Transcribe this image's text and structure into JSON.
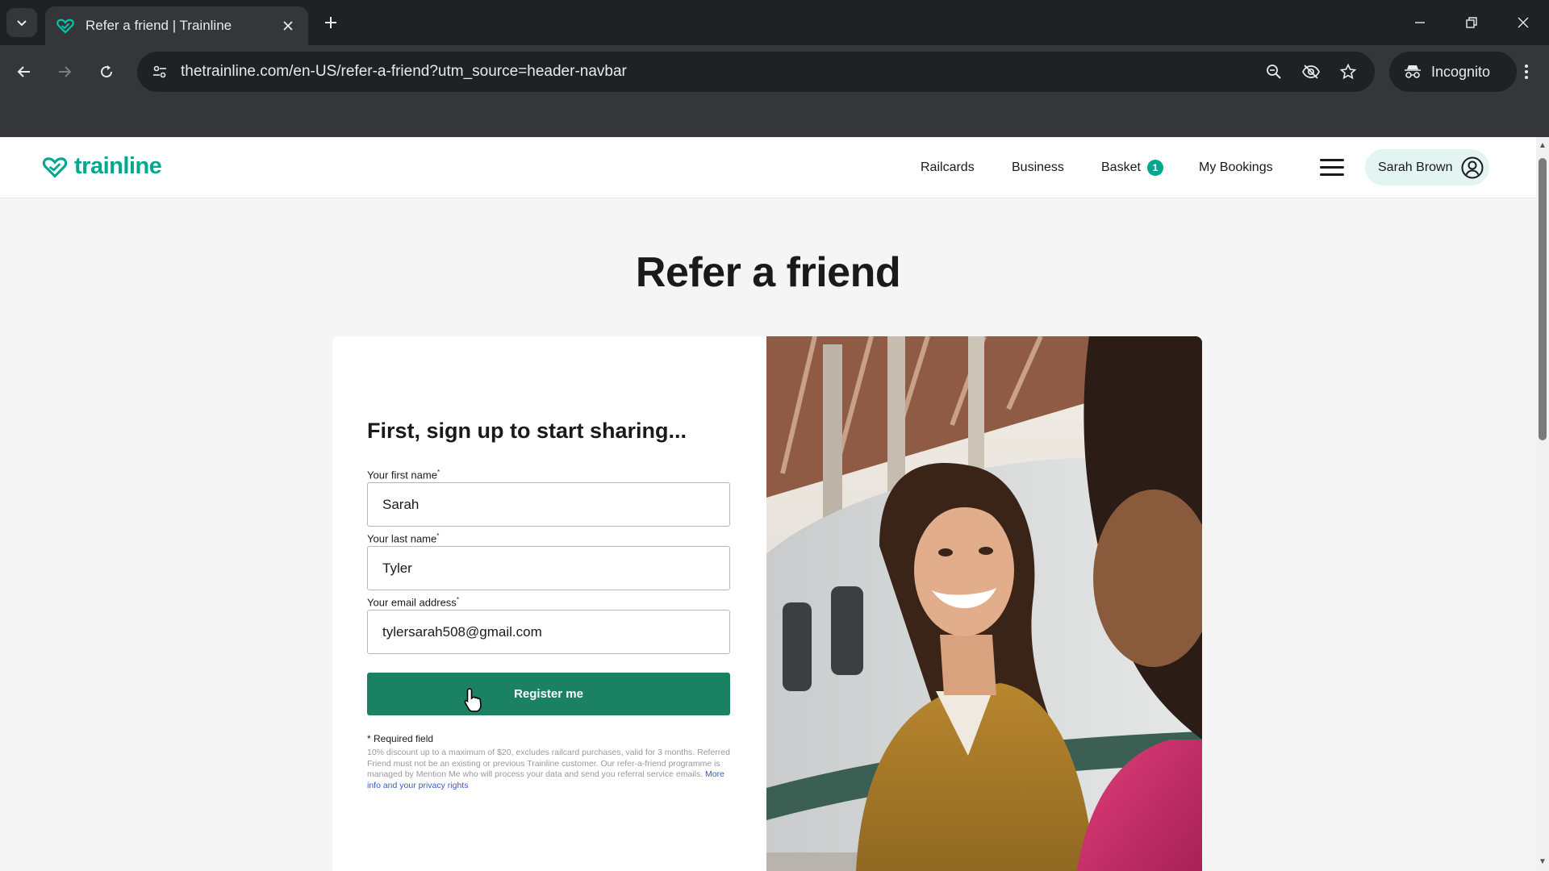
{
  "browser": {
    "tab_title": "Refer a friend | Trainline",
    "url": "thetrainline.com/en-US/refer-a-friend?utm_source=header-navbar",
    "incognito_label": "Incognito"
  },
  "header": {
    "logo_text": "trainline",
    "nav": {
      "railcards": "Railcards",
      "business": "Business",
      "basket": "Basket",
      "basket_count": "1",
      "bookings": "My Bookings"
    },
    "user_name": "Sarah Brown"
  },
  "page": {
    "title": "Refer a friend"
  },
  "form": {
    "heading": "First, sign up to start sharing...",
    "first_name_label": "Your first name",
    "first_name_value": "Sarah",
    "last_name_label": "Your last name",
    "last_name_value": "Tyler",
    "email_label": "Your email address",
    "email_value": "tylersarah508@gmail.com",
    "required_marker": "*",
    "submit_label": "Register me",
    "required_note": "* Required field",
    "fine_print": "10% discount up to a maximum of $20, excludes railcard purchases, valid for 3 months. Referred Friend must not be an existing or previous Trainline customer. Our refer-a-friend programme is managed by Mention Me who will process your data and send you referral service emails.",
    "privacy_link": "More info and your privacy rights"
  },
  "colors": {
    "brand": "#00a88f",
    "button": "#1a8262"
  }
}
